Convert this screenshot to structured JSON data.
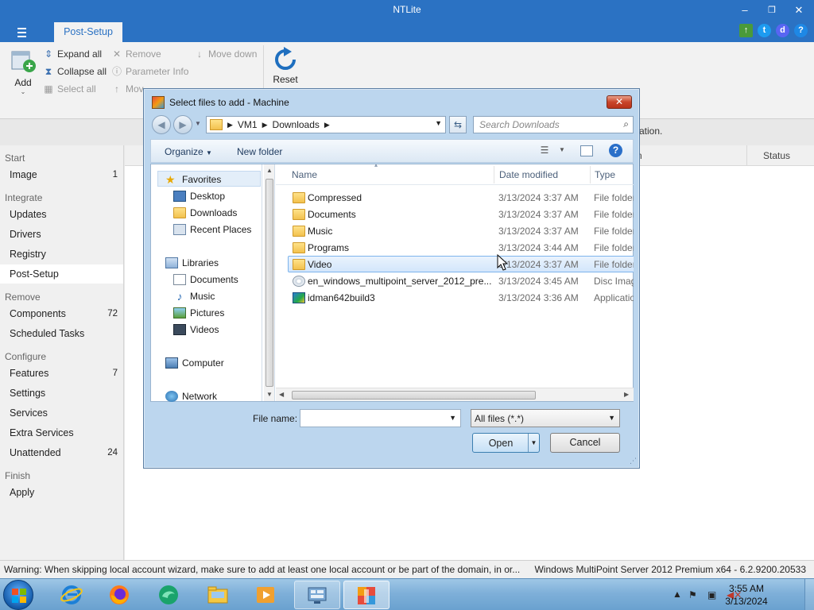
{
  "app": {
    "title": "NTLite",
    "tab": "Post-Setup",
    "info_fragment": "ation."
  },
  "window_buttons": {
    "minimize": "–",
    "restore": "❐",
    "close": "✕"
  },
  "ribbon": {
    "add": "Add",
    "expand_all": "Expand all",
    "collapse_all": "Collapse all",
    "select_all": "Select all",
    "remove": "Remove",
    "parameter_info": "Parameter Info",
    "move_down": "Move down",
    "move_up_partial": "Mov",
    "reset": "Reset"
  },
  "sidebar": {
    "start": "Start",
    "image": "Image",
    "image_count": "1",
    "integrate": "Integrate",
    "updates": "Updates",
    "drivers": "Drivers",
    "registry": "Registry",
    "post_setup": "Post-Setup",
    "remove": "Remove",
    "components": "Components",
    "components_count": "72",
    "scheduled_tasks": "Scheduled Tasks",
    "configure": "Configure",
    "features": "Features",
    "features_count": "7",
    "settings": "Settings",
    "services": "Services",
    "extra_services": "Extra Services",
    "unattended": "Unattended",
    "unattended_count": "24",
    "finish": "Finish",
    "apply": "Apply"
  },
  "content": {
    "col_n": "n",
    "col_status": "Status"
  },
  "statusbar": {
    "warning": "Warning: When skipping local account wizard, make sure to add at least one local account or be part of the domain, in or...",
    "os": "Windows MultiPoint Server 2012 Premium x64 - 6.2.9200.20533"
  },
  "dialog": {
    "title": "Select files to add - Machine",
    "close": "✕",
    "path": [
      "VM1",
      "Downloads"
    ],
    "search_placeholder": "Search Downloads",
    "organize": "Organize",
    "new_folder": "New folder",
    "nav": {
      "favorites": "Favorites",
      "desktop": "Desktop",
      "downloads": "Downloads",
      "recent_places": "Recent Places",
      "libraries": "Libraries",
      "documents": "Documents",
      "music": "Music",
      "pictures": "Pictures",
      "videos": "Videos",
      "computer": "Computer",
      "network": "Network"
    },
    "columns": {
      "name": "Name",
      "date": "Date modified",
      "type": "Type"
    },
    "files": [
      {
        "name": "Compressed",
        "date": "3/13/2024 3:37 AM",
        "type": "File folder"
      },
      {
        "name": "Documents",
        "date": "3/13/2024 3:37 AM",
        "type": "File folder"
      },
      {
        "name": "Music",
        "date": "3/13/2024 3:37 AM",
        "type": "File folder"
      },
      {
        "name": "Programs",
        "date": "3/13/2024 3:44 AM",
        "type": "File folder"
      },
      {
        "name": "Video",
        "date": "3/13/2024 3:37 AM",
        "type": "File folder"
      },
      {
        "name": "en_windows_multipoint_server_2012_pre...",
        "date": "3/13/2024 3:45 AM",
        "type": "Disc Image"
      },
      {
        "name": "idman642build3",
        "date": "3/13/2024 3:36 AM",
        "type": "Application"
      }
    ],
    "file_name_label": "File name:",
    "file_name_value": "",
    "filter": "All files (*.*)",
    "open": "Open",
    "cancel": "Cancel"
  },
  "taskbar": {
    "time": "3:55 AM",
    "date": "3/13/2024"
  }
}
